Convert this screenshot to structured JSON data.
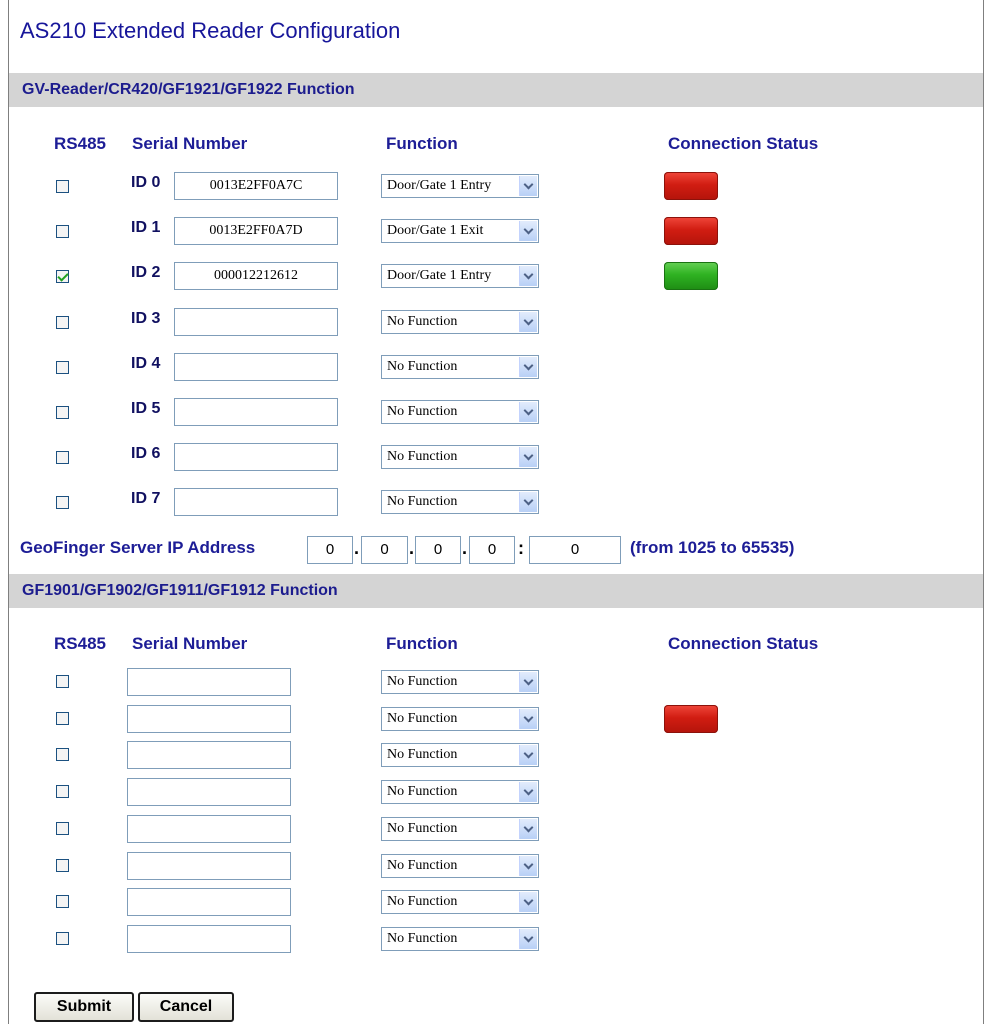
{
  "page_title": "AS210 Extended Reader Configuration",
  "section1": {
    "title": "GV-Reader/CR420/GF1921/GF1922 Function",
    "headers": {
      "rs485": "RS485",
      "serial": "Serial Number",
      "function": "Function",
      "status": "Connection Status"
    },
    "rows": [
      {
        "id": "ID 0",
        "checked": false,
        "serial": "0013E2FF0A7C",
        "function": "Door/Gate 1 Entry",
        "status": "red"
      },
      {
        "id": "ID 1",
        "checked": false,
        "serial": "0013E2FF0A7D",
        "function": "Door/Gate 1 Exit",
        "status": "red"
      },
      {
        "id": "ID 2",
        "checked": true,
        "serial": "000012212612",
        "function": "Door/Gate 1 Entry",
        "status": "green"
      },
      {
        "id": "ID 3",
        "checked": false,
        "serial": "",
        "function": "No Function",
        "status": ""
      },
      {
        "id": "ID 4",
        "checked": false,
        "serial": "",
        "function": "No Function",
        "status": ""
      },
      {
        "id": "ID 5",
        "checked": false,
        "serial": "",
        "function": "No Function",
        "status": ""
      },
      {
        "id": "ID 6",
        "checked": false,
        "serial": "",
        "function": "No Function",
        "status": ""
      },
      {
        "id": "ID 7",
        "checked": false,
        "serial": "",
        "function": "No Function",
        "status": ""
      }
    ]
  },
  "geofinger": {
    "label": "GeoFinger Server IP Address",
    "octets": [
      "0",
      "0",
      "0",
      "0"
    ],
    "dot": ".",
    "colon": ":",
    "port": "0",
    "port_hint": "(from 1025 to 65535)"
  },
  "section2": {
    "title": "GF1901/GF1902/GF1911/GF1912 Function",
    "headers": {
      "rs485": "RS485",
      "serial": "Serial Number",
      "function": "Function",
      "status": "Connection Status"
    },
    "rows": [
      {
        "checked": false,
        "serial": "",
        "function": "No Function",
        "status": ""
      },
      {
        "checked": false,
        "serial": "",
        "function": "No Function",
        "status": "red"
      },
      {
        "checked": false,
        "serial": "",
        "function": "No Function",
        "status": ""
      },
      {
        "checked": false,
        "serial": "",
        "function": "No Function",
        "status": ""
      },
      {
        "checked": false,
        "serial": "",
        "function": "No Function",
        "status": ""
      },
      {
        "checked": false,
        "serial": "",
        "function": "No Function",
        "status": ""
      },
      {
        "checked": false,
        "serial": "",
        "function": "No Function",
        "status": ""
      },
      {
        "checked": false,
        "serial": "",
        "function": "No Function",
        "status": ""
      }
    ]
  },
  "buttons": {
    "submit": "Submit",
    "cancel": "Cancel"
  },
  "colors": {
    "status_red": "#d11d12",
    "status_green": "#2fb222",
    "section_bar": "#d4d4d4",
    "text_blue": "#1d1d96"
  }
}
